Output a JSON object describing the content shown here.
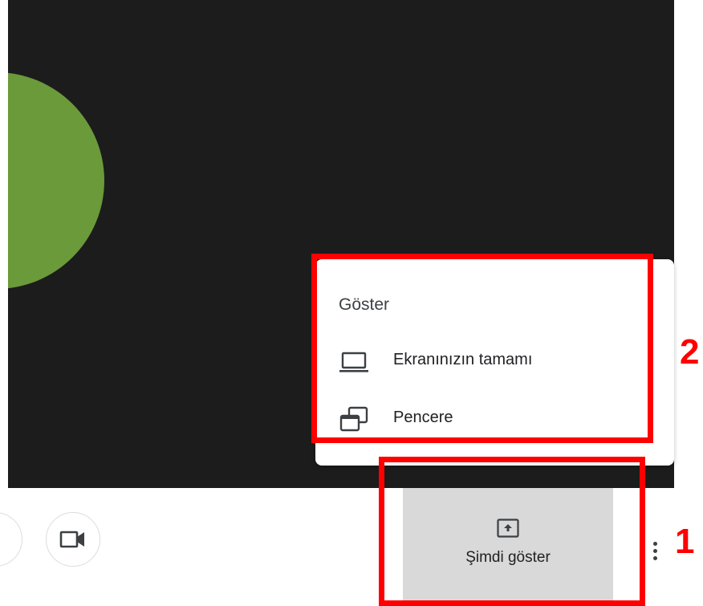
{
  "colors": {
    "video_bg": "#1c1c1c",
    "avatar": "#6b9a3a",
    "annotation": "#ff0000",
    "present_bg": "#d9d9d9"
  },
  "popup": {
    "title": "Göster",
    "items": [
      {
        "icon": "laptop-icon",
        "label": "Ekranınızın tamamı"
      },
      {
        "icon": "window-icon",
        "label": "Pencere"
      }
    ]
  },
  "toolbar": {
    "present_label": "Şimdi göster",
    "present_icon": "present-upload-icon",
    "camera_icon": "camera-icon",
    "more_icon": "more-vertical-icon"
  },
  "annotations": {
    "label_1": "1",
    "label_2": "2"
  }
}
